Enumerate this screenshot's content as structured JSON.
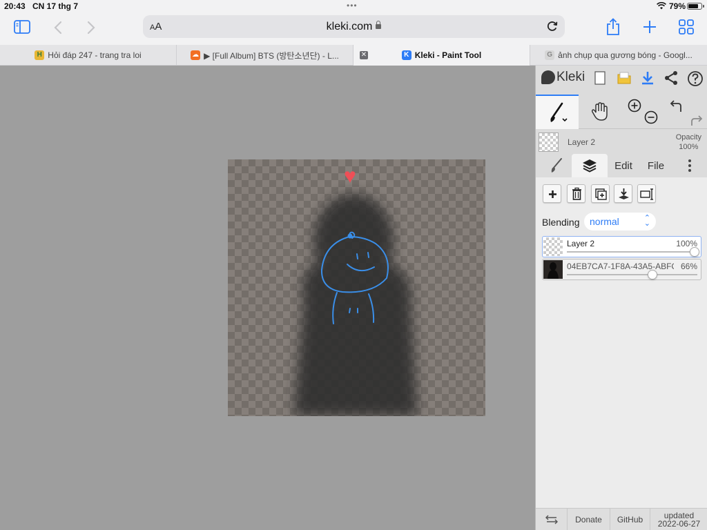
{
  "status": {
    "time": "20:43",
    "date": "CN 17 thg 7",
    "battery_pct": "79%",
    "battery_level": 0.79
  },
  "browser": {
    "aa_small": "A",
    "aa_big": "A",
    "url": "kleki.com",
    "tabs": [
      {
        "label": "Hỏi đáp 247 - trang tra loi",
        "favicon": "H"
      },
      {
        "label": "▶ [Full Album] BTS (방탄소년단) - L...",
        "favicon": "☁"
      },
      {
        "label": "Kleki - Paint Tool",
        "favicon": "K"
      },
      {
        "label": "ảnh chụp qua gương bóng - Googl...",
        "favicon": "G"
      }
    ]
  },
  "kleki": {
    "brand": "Kleki",
    "current_layer": "Layer 2",
    "opacity_label": "Opacity",
    "opacity_value": "100%",
    "subtabs": {
      "edit": "Edit",
      "file": "File"
    },
    "blending_label": "Blending",
    "blending_value": "normal",
    "layers": [
      {
        "name": "Layer 2",
        "opacity": "100%",
        "opacity_level": 1.0
      },
      {
        "name": "04EB7CA7-1F8A-43A5-ABFC",
        "opacity": "66%",
        "opacity_level": 0.66
      }
    ],
    "footer": {
      "donate": "Donate",
      "github": "GitHub",
      "updated_label": "updated",
      "updated_date": "2022-06-27"
    }
  },
  "colors": {
    "accent": "#2d7cf6",
    "stroke": "#3a8ee8",
    "heart": "#ef4f57"
  }
}
